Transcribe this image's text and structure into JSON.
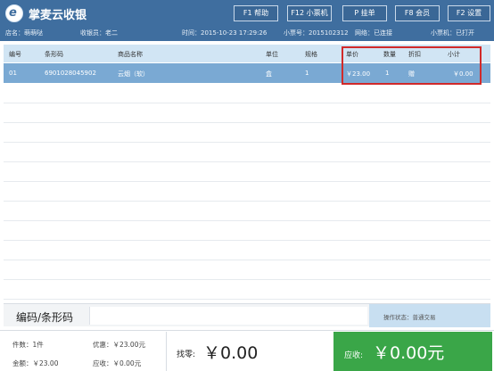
{
  "app": {
    "title": "掌麦云收银",
    "logo_letter": "e"
  },
  "header_buttons": [
    {
      "label": "F1 帮助"
    },
    {
      "label": "F12 小票机"
    },
    {
      "label": "P 挂单"
    },
    {
      "label": "F8 会员"
    },
    {
      "label": "F2 设置"
    }
  ],
  "info_bar": {
    "store": "店名：萌萌哒",
    "cashier": "收银员：老二",
    "time": "时间：2015-10-23 17:29:26",
    "ticket_no": "小票号：2015102312",
    "network": "网络：已连接",
    "printer": "小票机：已打开"
  },
  "table": {
    "columns": [
      "编号",
      "条形码",
      "商品名称",
      "单位",
      "规格",
      "单价",
      "数量",
      "折扣",
      "小计"
    ],
    "rows": [
      [
        "01",
        "6901028045902",
        "云烟（软）",
        "盒",
        "1",
        "￥23.00",
        "1",
        "赠",
        "￥0.00"
      ]
    ]
  },
  "barcode": {
    "label": "编码/条形码",
    "value": "",
    "op_status": "操作状态：普通交易"
  },
  "summary": {
    "count": "件数：1件",
    "discount": "优惠：￥23.00元",
    "amount": "金额：￥23.00",
    "received": "应收：￥0.00元",
    "change_label": "找零:",
    "change_value": "￥0.00",
    "due_label": "应收:",
    "due_value": "￥0.00元"
  },
  "colors": {
    "header_bg": "#3f6e9f",
    "selected_row": "#7aa9d3",
    "highlight_box": "#d12a2a",
    "due_bg": "#3aa648"
  }
}
